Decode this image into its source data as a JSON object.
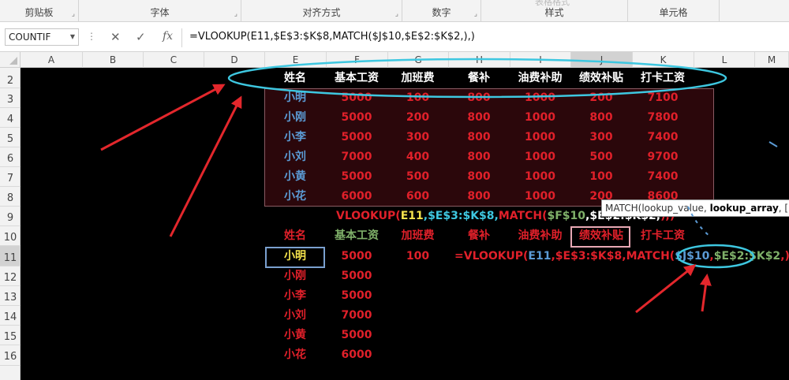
{
  "ribbon": {
    "groups": [
      {
        "label": "剪贴板"
      },
      {
        "label": "字体"
      },
      {
        "label": "对齐方式"
      },
      {
        "label": "数字"
      },
      {
        "label": "样式"
      },
      {
        "label": "单元格"
      }
    ],
    "faint_top": "表格格式"
  },
  "formula_bar": {
    "name_box": "COUNTIF",
    "cancel_icon": "✕",
    "enter_icon": "✓",
    "fx_label": "fx",
    "formula": "=VLOOKUP(E11,$E$3:$K$8,MATCH($J$10,$E$2:$K$2,),)"
  },
  "columns": [
    "A",
    "B",
    "C",
    "D",
    "E",
    "F",
    "G",
    "H",
    "I",
    "J",
    "K",
    "L",
    "M"
  ],
  "rows": [
    "2",
    "3",
    "4",
    "5",
    "6",
    "7",
    "8",
    "9",
    "10",
    "11",
    "12",
    "13",
    "14",
    "15",
    "16"
  ],
  "table": {
    "headers": [
      "姓名",
      "基本工资",
      "加班费",
      "餐补",
      "油费补助",
      "绩效补贴",
      "打卡工资"
    ],
    "rows": [
      [
        "小明",
        "5000",
        "100",
        "800",
        "1000",
        "200",
        "7100"
      ],
      [
        "小刚",
        "5000",
        "200",
        "800",
        "1000",
        "800",
        "7800"
      ],
      [
        "小李",
        "5000",
        "300",
        "800",
        "1000",
        "300",
        "7400"
      ],
      [
        "小刘",
        "7000",
        "400",
        "800",
        "1000",
        "500",
        "9700"
      ],
      [
        "小黄",
        "5000",
        "500",
        "800",
        "1000",
        "100",
        "7400"
      ],
      [
        "小花",
        "6000",
        "600",
        "800",
        "1000",
        "200",
        "8600"
      ]
    ]
  },
  "row9_formula": {
    "p1": "VLOOKUP(",
    "p2": "E11",
    "p3": ",$E$3:$K$8,",
    "p4": "MATCH(",
    "p5": "$F$10",
    "p6": ",$E$2:$K$2,",
    "p7": "),)"
  },
  "lower": {
    "headers": [
      "姓名",
      "基本工资",
      "加班费",
      "餐补",
      "油费补助",
      "绩效补贴",
      "打卡工资"
    ],
    "names": [
      "小明",
      "小刚",
      "小李",
      "小刘",
      "小黄",
      "小花"
    ],
    "base": [
      "5000",
      "5000",
      "5000",
      "7000",
      "5000",
      "6000"
    ],
    "overtime_first": "100"
  },
  "row11_formula": {
    "p1": "=VLOOKUP(",
    "p2": "E11",
    "p3": ",$E$3:$K$8,",
    "p4": "MATCH(",
    "p5": "$J$10",
    "p6": ",",
    "p7": "$E$2:$K$2",
    "p8": ",),"
  },
  "tooltip": {
    "p1": "MATCH(lookup_value, ",
    "p2": "lookup_array",
    "p3": ", [matc"
  },
  "colors": {
    "header_white": "#ffffff",
    "name_blue": "#5b9bd5",
    "value_red": "#e0202a",
    "lower_green": "#7fb069",
    "annotation_cyan": "#3ec7e0",
    "arrow_red": "#e3272c"
  }
}
